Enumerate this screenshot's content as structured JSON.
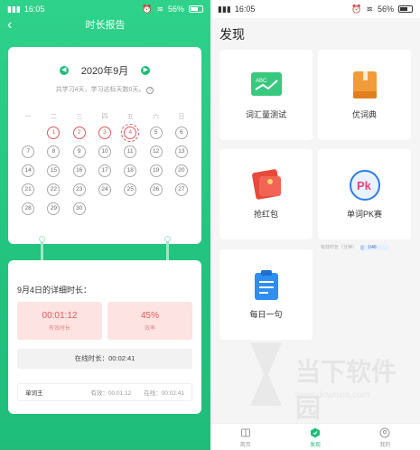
{
  "left": {
    "status": {
      "time": "16:05",
      "speed": "1.20\nKB/s",
      "battery": "56%"
    },
    "title": "时长报告",
    "calendar": {
      "month": "2020年9月",
      "summary": "共学习4天，学习达标天数0天。",
      "weekdays": [
        "一",
        "二",
        "三",
        "四",
        "五",
        "六",
        "日"
      ],
      "days": [
        "1",
        "2",
        "3",
        "4",
        "5",
        "6",
        "7",
        "8",
        "9",
        "10",
        "11",
        "12",
        "13",
        "14",
        "15",
        "16",
        "17",
        "18",
        "19",
        "20",
        "21",
        "22",
        "23",
        "24",
        "25",
        "26",
        "27",
        "28",
        "29",
        "30"
      ]
    },
    "detail": {
      "title": "9月4日的详细时长：",
      "effective_value": "00:01:12",
      "effective_label": "有效时长",
      "efficiency_value": "45%",
      "efficiency_label": "效率",
      "online": "在线时长：00:02:41",
      "app_name": "单词王",
      "app_effective": "有效：00:01:12",
      "app_online": "在线：00:02:41"
    }
  },
  "right": {
    "status": {
      "time": "16:05",
      "speed": "1.20\nKB/s",
      "battery": "56%"
    },
    "title": "发现",
    "tiles": [
      {
        "label": "词汇量测试",
        "icon": "vocab-test-icon",
        "icon_text": "ABC"
      },
      {
        "label": "优词典",
        "icon": "dictionary-icon"
      },
      {
        "label": "抢红包",
        "icon": "red-packet-icon"
      },
      {
        "label": "单词PK赛",
        "icon": "pk-icon",
        "icon_text": "Pk"
      },
      {
        "label": "每日一句",
        "icon": "daily-sentence-icon"
      }
    ],
    "progress": {
      "label": "有效时长（分钟）",
      "value": "1/46",
      "fraction": 0.12
    },
    "tabs": [
      {
        "label": "首页",
        "icon": "home-icon"
      },
      {
        "label": "发现",
        "icon": "discover-icon"
      },
      {
        "label": "我的",
        "icon": "profile-icon"
      }
    ],
    "watermark": {
      "text": "当下软件园",
      "url": "www.downxia.com"
    }
  },
  "colors": {
    "accent": "#1fbd79",
    "studied": "#e05a5a",
    "stat_bg": "#fde3e1"
  }
}
